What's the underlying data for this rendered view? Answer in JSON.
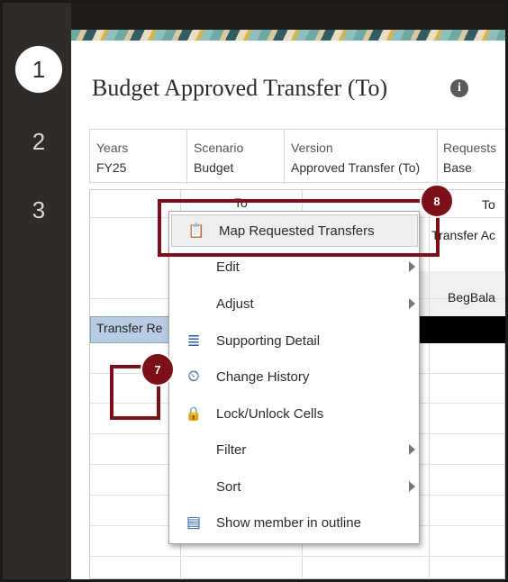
{
  "steps": [
    "1",
    "2",
    "3"
  ],
  "page": {
    "title": "Budget Approved Transfer (To)",
    "info_icon": "i"
  },
  "pov": [
    {
      "label": "Years",
      "value": "FY25"
    },
    {
      "label": "Scenario",
      "value": "Budget"
    },
    {
      "label": "Version",
      "value": "Approved Transfer (To)"
    },
    {
      "label": "Requests",
      "value": "Base"
    }
  ],
  "grid": {
    "col_header_partial_1": "To",
    "col_header_to": "To",
    "col_header_transfer": "Transfer Ac",
    "col_header_begbal": "BegBala",
    "row_header": "Transfer Re"
  },
  "context_menu": {
    "items": [
      {
        "label": "Map Requested Transfers",
        "icon": "map-transfers-icon",
        "glyph": "📋"
      },
      {
        "label": "Edit",
        "submenu": true
      },
      {
        "label": "Adjust",
        "submenu": true
      },
      {
        "label": "Supporting Detail",
        "icon": "supporting-detail-icon",
        "glyph": "≣"
      },
      {
        "label": "Change History",
        "icon": "change-history-icon",
        "glyph": "⏲"
      },
      {
        "label": "Lock/Unlock Cells",
        "icon": "lock-icon",
        "glyph": "🔒"
      },
      {
        "label": "Filter",
        "submenu": true
      },
      {
        "label": "Sort",
        "submenu": true
      },
      {
        "label": "Show member in outline",
        "icon": "outline-icon",
        "glyph": "▤"
      }
    ]
  },
  "annotations": {
    "badge_7": "7",
    "badge_8": "8",
    "color": "#7b1018"
  }
}
